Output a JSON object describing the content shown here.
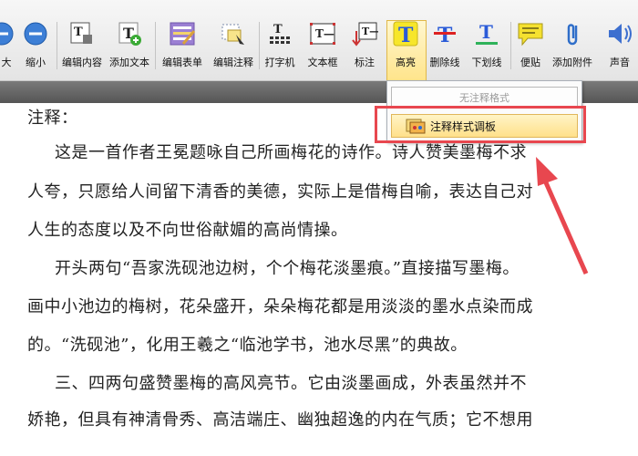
{
  "toolbar": {
    "zoom_in_label": "大",
    "zoom_out_label": "缩小",
    "edit_content_label": "编辑内容",
    "add_text_label": "添加文本",
    "edit_form_label": "编辑表单",
    "edit_annotation_label": "编辑注释",
    "typewriter_label": "打字机",
    "textbox_label": "文本框",
    "callout_label": "标注",
    "highlight_label": "高亮",
    "strikeout_label": "删除线",
    "underline_label": "下划线",
    "sticky_label": "便贴",
    "attach_label": "添加附件",
    "sound_label": "声音"
  },
  "dropdown": {
    "no_style_label": "无注释格式",
    "style_palette_label": "注释样式调板"
  },
  "document": {
    "lines": [
      "注释：",
      "这是一首作者王冕题咏自己所画梅花的诗作。诗人赞美墨梅不求",
      "人夸，只愿给人间留下清香的美德，实际上是借梅自喻，表达自己对",
      "人生的态度以及不向世俗献媚的高尚情操。",
      "开头两句“吾家洗砚池边树，个个梅花淡墨痕。”直接描写墨梅。",
      "画中小池边的梅树，花朵盛开，朵朵梅花都是用淡淡的墨水点染而成",
      "的。“洗砚池”，化用王羲之“临池学书，池水尽黑”的典故。",
      "三、四两句盛赞墨梅的高风亮节。它由淡墨画成，外表虽然并不",
      "娇艳，但具有神清骨秀、高洁端庄、幽独超逸的内在气质；它不想用"
    ]
  },
  "colors": {
    "highlight_annotation_red": "#e8474f",
    "active_button": "#ffe48a"
  }
}
